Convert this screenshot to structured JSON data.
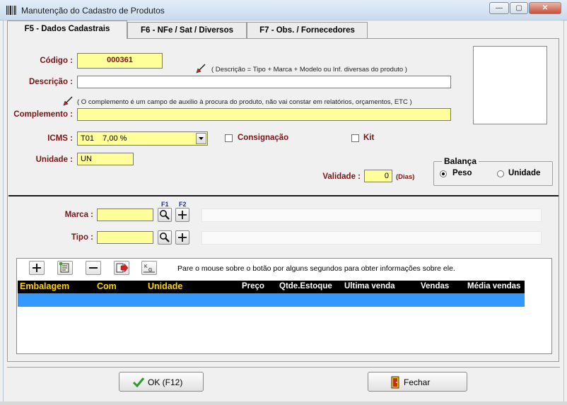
{
  "window": {
    "title": "Manutenção do Cadastro de Produtos",
    "minimize": "—",
    "maximize": "▢",
    "close": "✕"
  },
  "tabs": [
    {
      "label": "F5 - Dados Cadastrais",
      "active": true
    },
    {
      "label": "F6 - NFe / Sat / Diversos",
      "active": false
    },
    {
      "label": "F7 - Obs. / Fornecedores",
      "active": false
    }
  ],
  "form": {
    "codigo_label": "Código :",
    "codigo_value": "000361",
    "descricao_label": "Descrição :",
    "descricao_value": "",
    "descricao_note": "( Descrição = Tipo + Marca + Modelo ou Inf. diversas do produto )",
    "complemento_note": "( O complemento é um campo de auxilio à procura do produto, não vai constar em relatórios, orçamentos, ETC )",
    "complemento_label": "Complemento :",
    "complemento_value": "",
    "icms_label": "ICMS :",
    "icms_value": "T01    7,00 %",
    "consignacao_label": "Consignação",
    "kit_label": "Kit",
    "unidade_label": "Unidade :",
    "unidade_value": "UN",
    "validade_label": "Validade :",
    "validade_value": "0",
    "validade_unit": "(Dias)",
    "balanca": {
      "legend": "Balança",
      "options": [
        "Peso",
        "Unidade"
      ],
      "selected": "Peso"
    }
  },
  "marca_tipo": {
    "f1": "F1",
    "f2": "F2",
    "marca_label": "Marca :",
    "marca_value": "",
    "marca_desc": "",
    "tipo_label": "Tipo :",
    "tipo_value": "",
    "tipo_desc": ""
  },
  "embalagens": {
    "hint": "Pare o mouse sobre o botão por alguns segundos para obter informações sobre ele.",
    "columns": [
      "Embalagem",
      "Com",
      "Unidade",
      "Preço",
      "Qtde.Estoque",
      "Ultima venda",
      "Vendas",
      "Média vendas"
    ],
    "rows": []
  },
  "footer": {
    "ok_label": "OK  (F12)",
    "fechar_label": "Fechar"
  },
  "colors": {
    "field_yellow": "#ffff99",
    "label_maroon": "#7a1414",
    "grid_header_bg": "#000000",
    "grid_selection": "#3399ff",
    "header_highlight": "#ffd400"
  }
}
